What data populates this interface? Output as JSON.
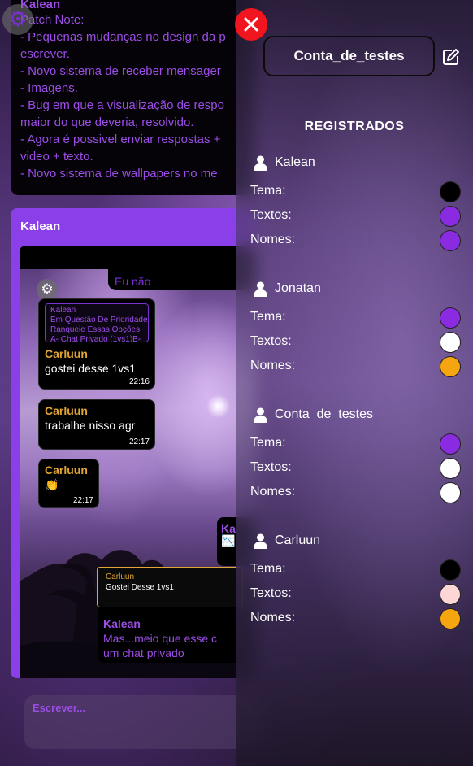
{
  "patch_note": {
    "author": "Kalean",
    "lines": [
      "Patch Note:",
      "- Pequenas mudanças no design da p",
      "escrever.",
      "- Novo sistema de receber mensager",
      "- Imagens.",
      "- Bug em que a visualização de respo",
      "maior do que deveria, resolvido.",
      "- Agora é possivel enviar respostas +",
      "video + texto.",
      "- Novo sistema de wallpapers no me"
    ]
  },
  "chat": {
    "title": "Kalean",
    "top_message": "Eu não",
    "messages": [
      {
        "quote": {
          "name": "Kalean",
          "lines": [
            "Em Questão De Prioridade,",
            "Ranqueie Essas Opções:",
            "A- Chat Privado (1vs1)B-"
          ]
        },
        "name": "Carluun",
        "text": "gostei desse 1vs1",
        "time": "22:16"
      },
      {
        "name": "Carluun",
        "text": "trabalhe nisso agr",
        "time": "22:17"
      },
      {
        "name": "Carluun",
        "text": "👏",
        "time": "22:17"
      }
    ],
    "side_message": {
      "name": "Ka",
      "icon": "chart-icon"
    },
    "reply": {
      "quote_name": "Carluun",
      "quote_text": "Gostei Desse 1vs1",
      "name": "Kalean",
      "lines": [
        "Mas...meio que esse c",
        "um chat privado"
      ]
    },
    "compose_placeholder": "Escrever..."
  },
  "panel": {
    "account_name": "Conta_de_testes",
    "section_title": "REGISTRADOS",
    "labels": {
      "tema": "Tema:",
      "textos": "Textos:",
      "nomes": "Nomes:"
    },
    "users": [
      {
        "name": "Kalean",
        "tema": "#000000",
        "textos": "#8a2be2",
        "nomes": "#8a2be2"
      },
      {
        "name": "Jonatan",
        "tema": "#8a2be2",
        "textos": "#ffffff",
        "nomes": "#f5a50f"
      },
      {
        "name": "Conta_de_testes",
        "tema": "#8a2be2",
        "textos": "#ffffff",
        "nomes": "#ffffff"
      },
      {
        "name": "Carluun",
        "tema": "#000000",
        "textos": "#ffd6d6",
        "nomes": "#f5a50f"
      }
    ]
  },
  "colors": {
    "accent": "#8b3fe8",
    "close": "#f0151f",
    "name_gold": "#e2a634"
  }
}
